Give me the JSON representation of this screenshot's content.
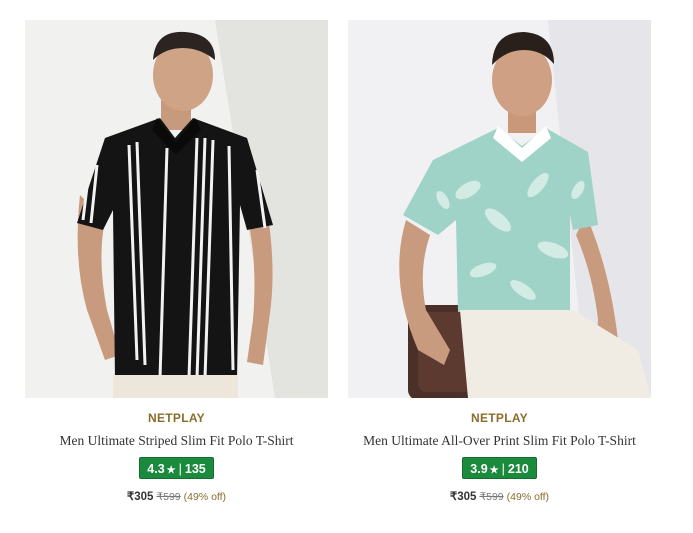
{
  "products": [
    {
      "brand": "NETPLAY",
      "title": "Men Ultimate Striped Slim Fit Polo T-Shirt",
      "rating": "4.3",
      "rating_count": "135",
      "price": "₹305",
      "mrp": "₹599",
      "discount": "(49% off)",
      "image_icon": "striped-polo-photo"
    },
    {
      "brand": "NETPLAY",
      "title": "Men Ultimate All-Over Print Slim Fit Polo T-Shirt",
      "rating": "3.9",
      "rating_count": "210",
      "price": "₹305",
      "mrp": "₹599",
      "discount": "(49% off)",
      "image_icon": "printed-polo-photo"
    }
  ],
  "colors": {
    "rating_badge": "#1a8a3c",
    "brand": "#8a6d2a"
  }
}
